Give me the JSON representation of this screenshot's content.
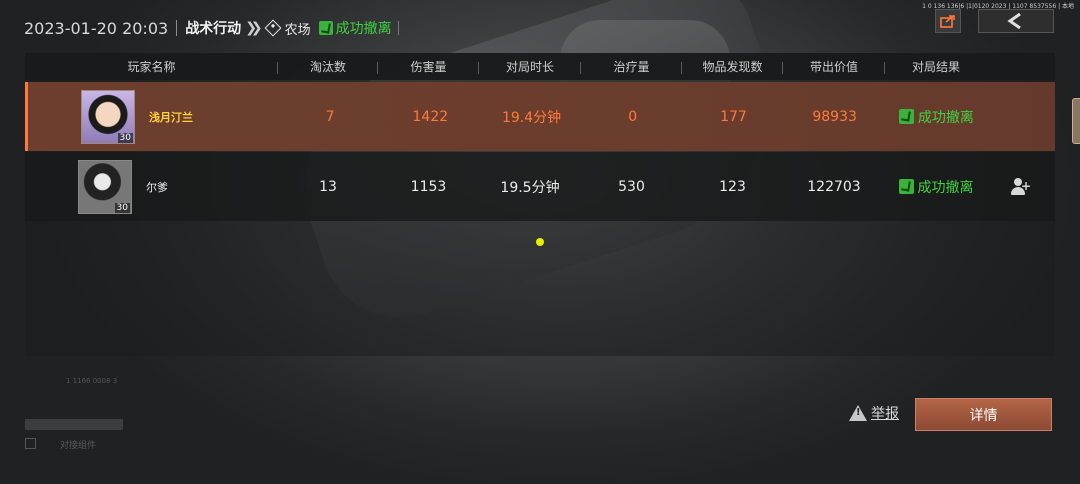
{
  "header": {
    "datetime": "2023-01-20 20:03",
    "mode": "战术行动",
    "map": "农场",
    "result": "成功撤离"
  },
  "top_meta": "1 0 136 136|6 |1|0120 2023 | 1107 8537556 | 本地",
  "table": {
    "columns": [
      "玩家名称",
      "淘汰数",
      "伤害量",
      "对局时长",
      "治疗量",
      "物品发现数",
      "带出价值",
      "对局结果"
    ],
    "rows": [
      {
        "name": "浅月汀兰",
        "level": "30",
        "kills": "7",
        "damage": "1422",
        "duration": "19.4分钟",
        "healing": "0",
        "items": "177",
        "value": "98933",
        "result": "成功撤离",
        "is_self": true
      },
      {
        "name": "尔爹",
        "level": "30",
        "kills": "13",
        "damage": "1153",
        "duration": "19.5分钟",
        "healing": "530",
        "items": "123",
        "value": "122703",
        "result": "成功撤离",
        "is_self": false
      }
    ]
  },
  "footer": {
    "report_label": "举报",
    "details_label": "详情",
    "faint_id": "1 1166 0008 3",
    "faint_text": "对接组件"
  },
  "colors": {
    "accent_orange": "#ff7a3a",
    "success_green": "#3fd23f",
    "self_row_bg": "#6b3d2d",
    "details_button": "#a05a3e"
  },
  "icons": {
    "share": "share-icon",
    "back": "back-arrow-icon",
    "success": "success-icon",
    "add_friend": "add-friend-icon",
    "report": "warning-icon"
  }
}
